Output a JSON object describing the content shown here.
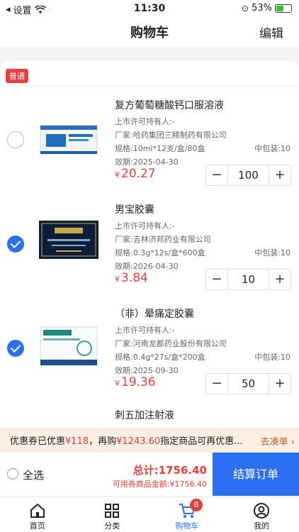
{
  "status": {
    "back_label": "设置",
    "time": "11:30",
    "battery": "53%",
    "battery_level": 0.53
  },
  "nav": {
    "title": "购物车",
    "edit": "编辑"
  },
  "tag": "普通",
  "items": [
    {
      "name": "复方葡萄糖酸钙口服溶液",
      "holder": "上市许可持有人:-",
      "maker": "厂家:哈药集团三精制药有限公司",
      "spec": "规格:10ml*12支/盒/80盒",
      "pack": "中包装:10",
      "expiry": "效期:2025-04-30",
      "price": "20.27",
      "qty": "100",
      "checked": false
    },
    {
      "name": "男宝胶囊",
      "holder": "上市许可持有人:-",
      "maker": "厂家:吉林济邦药业有限公司",
      "spec": "规格:0.3g*12s/盒*600盒",
      "pack": "中包装:10",
      "expiry": "效期:2026-04-30",
      "price": "3.84",
      "qty": "10",
      "checked": true
    },
    {
      "name": "（非）晕痛定胶囊",
      "holder": "上市许可持有人:-",
      "maker": "厂家:河南龙都药业股份有限公司",
      "spec": "规格:0.4g*27s/盒*200盒",
      "pack": "中包装:10",
      "expiry": "效期:2025-09-30",
      "price": "19.36",
      "qty": "50",
      "checked": true
    },
    {
      "name": "刺五加注射液"
    }
  ],
  "currency": "¥",
  "coupon": {
    "prefix": "优惠券已优惠",
    "amount1": "¥118",
    "mid": "，再购",
    "amount2": "¥1243.60",
    "suffix": "指定商品可再优惠...",
    "link": "去凑单"
  },
  "checkout": {
    "select_all": "全选",
    "total": "总计:1756.40",
    "coupon_total": "可用券商品金额:¥1756.40",
    "button": "结算订单"
  },
  "tabs": [
    {
      "label": "首页",
      "icon": "home-icon"
    },
    {
      "label": "分类",
      "icon": "category-icon"
    },
    {
      "label": "购物车",
      "icon": "cart-icon",
      "badge": "8",
      "active": true
    },
    {
      "label": "我的",
      "icon": "profile-icon"
    }
  ],
  "colors": {
    "accent": "#2c6ff0",
    "price": "#e8403c"
  }
}
